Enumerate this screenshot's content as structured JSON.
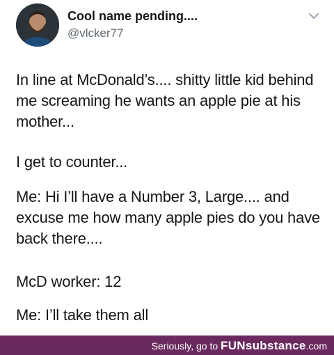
{
  "tweet": {
    "display_name": "Cool name pending....",
    "handle": "@vlcker77",
    "menu_icon": "chevron-down-icon",
    "paragraphs": [
      "In line at McDonald’s.... shitty little kid behind me screaming he wants an apple pie at his mother...",
      "I get to counter...",
      "Me: Hi I’ll have a Number 3, Large.... and excuse me how many apple pies do you have back there....",
      "McD worker: 12",
      "Me: I’ll take them all"
    ]
  },
  "footer": {
    "prefix": "Seriously, go to ",
    "brand_bold": "FUN",
    "brand_rest": "substance",
    "brand_suffix": ".com",
    "background": "#6b2a5f"
  },
  "colors": {
    "text": "#14171a",
    "handle": "#5b6770",
    "footer_bg": "#6b2a5f"
  }
}
